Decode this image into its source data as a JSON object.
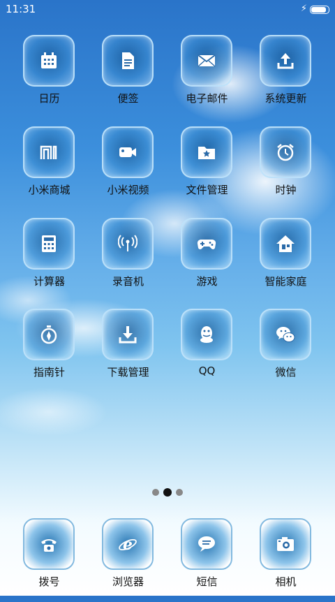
{
  "status_bar": {
    "time": "11:31",
    "battery_level": 0.95
  },
  "apps": [
    {
      "label": "日历",
      "icon": "calendar-icon"
    },
    {
      "label": "便签",
      "icon": "notes-icon"
    },
    {
      "label": "电子邮件",
      "icon": "email-icon"
    },
    {
      "label": "系统更新",
      "icon": "update-icon"
    },
    {
      "label": "小米商城",
      "icon": "mi-store-icon"
    },
    {
      "label": "小米视频",
      "icon": "video-camera-icon"
    },
    {
      "label": "文件管理",
      "icon": "folder-icon"
    },
    {
      "label": "时钟",
      "icon": "alarm-clock-icon"
    },
    {
      "label": "计算器",
      "icon": "calculator-icon"
    },
    {
      "label": "录音机",
      "icon": "recorder-icon"
    },
    {
      "label": "游戏",
      "icon": "gamepad-icon"
    },
    {
      "label": "智能家庭",
      "icon": "smart-home-icon"
    },
    {
      "label": "指南针",
      "icon": "compass-icon"
    },
    {
      "label": "下载管理",
      "icon": "download-icon"
    },
    {
      "label": "QQ",
      "icon": "qq-icon"
    },
    {
      "label": "微信",
      "icon": "wechat-icon"
    }
  ],
  "page_indicator": {
    "total": 3,
    "current": 2
  },
  "dock": [
    {
      "label": "拨号",
      "icon": "phone-icon"
    },
    {
      "label": "浏览器",
      "icon": "browser-icon"
    },
    {
      "label": "短信",
      "icon": "message-icon"
    },
    {
      "label": "相机",
      "icon": "camera-icon"
    }
  ]
}
